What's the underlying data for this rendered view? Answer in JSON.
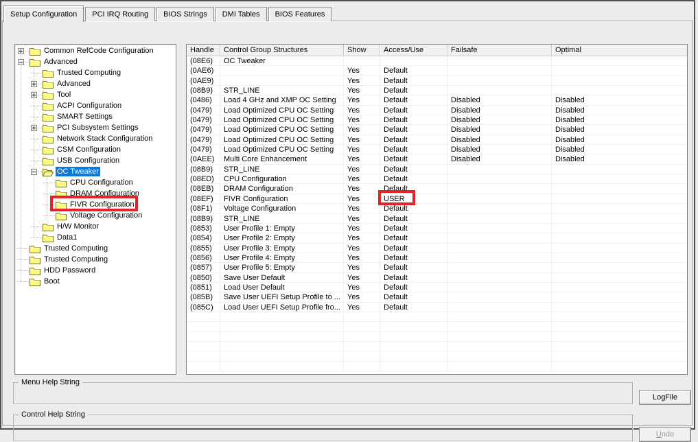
{
  "tabs": [
    {
      "label": "Setup Configuration",
      "active": true
    },
    {
      "label": "PCI IRQ Routing",
      "active": false
    },
    {
      "label": "BIOS Strings",
      "active": false
    },
    {
      "label": "DMI Tables",
      "active": false
    },
    {
      "label": "BIOS Features",
      "active": false
    }
  ],
  "tree": {
    "items": [
      {
        "label": "Common RefCode Configuration",
        "level": 0,
        "expander": "plus",
        "icon": "folder-closed-icon"
      },
      {
        "label": "Advanced",
        "level": 0,
        "expander": "minus",
        "icon": "folder-closed-icon"
      },
      {
        "label": "Trusted Computing",
        "level": 1,
        "expander": null,
        "icon": "folder-closed-icon"
      },
      {
        "label": "Advanced",
        "level": 1,
        "expander": "plus",
        "icon": "folder-closed-icon"
      },
      {
        "label": "Tool",
        "level": 1,
        "expander": "plus",
        "icon": "folder-closed-icon"
      },
      {
        "label": "ACPI Configuration",
        "level": 1,
        "expander": null,
        "icon": "folder-closed-icon"
      },
      {
        "label": "SMART Settings",
        "level": 1,
        "expander": null,
        "icon": "folder-closed-icon"
      },
      {
        "label": "PCI Subsystem Settings",
        "level": 1,
        "expander": "plus",
        "icon": "folder-closed-icon"
      },
      {
        "label": "Network Stack Configuration",
        "level": 1,
        "expander": null,
        "icon": "folder-closed-icon"
      },
      {
        "label": "CSM Configuration",
        "level": 1,
        "expander": null,
        "icon": "folder-closed-icon"
      },
      {
        "label": "USB Configuration",
        "level": 1,
        "expander": null,
        "icon": "folder-closed-icon"
      },
      {
        "label": "OC Tweaker",
        "level": 1,
        "expander": "minus",
        "icon": "folder-open-icon",
        "selected": true
      },
      {
        "label": "CPU Configuration",
        "level": 2,
        "expander": null,
        "icon": "folder-closed-icon"
      },
      {
        "label": "DRAM Configuration",
        "level": 2,
        "expander": null,
        "icon": "folder-closed-icon"
      },
      {
        "label": "FIVR Configuration",
        "level": 2,
        "expander": null,
        "icon": "folder-closed-icon",
        "red_box": true
      },
      {
        "label": "Voltage Configuration",
        "level": 2,
        "expander": null,
        "icon": "folder-closed-icon"
      },
      {
        "label": "H/W Monitor",
        "level": 1,
        "expander": null,
        "icon": "folder-closed-icon"
      },
      {
        "label": "Data1",
        "level": 1,
        "expander": null,
        "icon": "folder-closed-icon"
      },
      {
        "label": "Trusted Computing",
        "level": 0,
        "expander": null,
        "icon": "folder-closed-icon"
      },
      {
        "label": "Trusted Computing",
        "level": 0,
        "expander": null,
        "icon": "folder-closed-icon"
      },
      {
        "label": "HDD Password",
        "level": 0,
        "expander": null,
        "icon": "folder-closed-icon"
      },
      {
        "label": "Boot",
        "level": 0,
        "expander": null,
        "icon": "folder-closed-icon"
      }
    ]
  },
  "table": {
    "columns": [
      "Handle",
      "Control Group Structures",
      "Show",
      "Access/Use",
      "Failsafe",
      "Optimal"
    ],
    "rows": [
      {
        "handle": "(08E6)",
        "name": "OC Tweaker",
        "show": "",
        "access": "",
        "failsafe": "",
        "optimal": ""
      },
      {
        "handle": "(0AE6)",
        "name": "",
        "show": "Yes",
        "access": "Default",
        "failsafe": "",
        "optimal": ""
      },
      {
        "handle": "(0AE9)",
        "name": "",
        "show": "Yes",
        "access": "Default",
        "failsafe": "",
        "optimal": ""
      },
      {
        "handle": "(08B9)",
        "name": "STR_LINE",
        "show": "Yes",
        "access": "Default",
        "failsafe": "",
        "optimal": ""
      },
      {
        "handle": "(0486)",
        "name": "Load 4 GHz and XMP OC Setting",
        "show": "Yes",
        "access": "Default",
        "failsafe": "Disabled",
        "optimal": "Disabled"
      },
      {
        "handle": "(0479)",
        "name": "Load Optimized CPU OC Setting",
        "show": "Yes",
        "access": "Default",
        "failsafe": "Disabled",
        "optimal": "Disabled"
      },
      {
        "handle": "(0479)",
        "name": "Load Optimized CPU OC Setting",
        "show": "Yes",
        "access": "Default",
        "failsafe": "Disabled",
        "optimal": "Disabled"
      },
      {
        "handle": "(0479)",
        "name": "Load Optimized CPU OC Setting",
        "show": "Yes",
        "access": "Default",
        "failsafe": "Disabled",
        "optimal": "Disabled"
      },
      {
        "handle": "(0479)",
        "name": "Load Optimized CPU OC Setting",
        "show": "Yes",
        "access": "Default",
        "failsafe": "Disabled",
        "optimal": "Disabled"
      },
      {
        "handle": "(0479)",
        "name": "Load Optimized CPU OC Setting",
        "show": "Yes",
        "access": "Default",
        "failsafe": "Disabled",
        "optimal": "Disabled"
      },
      {
        "handle": "(0AEE)",
        "name": "Multi Core Enhancement",
        "show": "Yes",
        "access": "Default",
        "failsafe": "Disabled",
        "optimal": "Disabled"
      },
      {
        "handle": "(08B9)",
        "name": "STR_LINE",
        "show": "Yes",
        "access": "Default",
        "failsafe": "",
        "optimal": ""
      },
      {
        "handle": "(08ED)",
        "name": "CPU Configuration",
        "show": "Yes",
        "access": "Default",
        "failsafe": "",
        "optimal": ""
      },
      {
        "handle": "(08EB)",
        "name": "DRAM Configuration",
        "show": "Yes",
        "access": "Default",
        "failsafe": "",
        "optimal": ""
      },
      {
        "handle": "(08EF)",
        "name": "FIVR Configuration",
        "show": "Yes",
        "access": "USER",
        "failsafe": "",
        "optimal": "",
        "red_box": true
      },
      {
        "handle": "(08F1)",
        "name": "Voltage Configuration",
        "show": "Yes",
        "access": "Default",
        "failsafe": "",
        "optimal": ""
      },
      {
        "handle": "(08B9)",
        "name": "STR_LINE",
        "show": "Yes",
        "access": "Default",
        "failsafe": "",
        "optimal": ""
      },
      {
        "handle": "(0853)",
        "name": "User Profile 1: Empty",
        "show": "Yes",
        "access": "Default",
        "failsafe": "",
        "optimal": ""
      },
      {
        "handle": "(0854)",
        "name": "User Profile 2: Empty",
        "show": "Yes",
        "access": "Default",
        "failsafe": "",
        "optimal": ""
      },
      {
        "handle": "(0855)",
        "name": "User Profile 3: Empty",
        "show": "Yes",
        "access": "Default",
        "failsafe": "",
        "optimal": ""
      },
      {
        "handle": "(0856)",
        "name": "User Profile 4: Empty",
        "show": "Yes",
        "access": "Default",
        "failsafe": "",
        "optimal": ""
      },
      {
        "handle": "(0857)",
        "name": "User Profile 5: Empty",
        "show": "Yes",
        "access": "Default",
        "failsafe": "",
        "optimal": ""
      },
      {
        "handle": "(0850)",
        "name": "Save User Default",
        "show": "Yes",
        "access": "Default",
        "failsafe": "",
        "optimal": ""
      },
      {
        "handle": "(0851)",
        "name": "Load User Default",
        "show": "Yes",
        "access": "Default",
        "failsafe": "",
        "optimal": ""
      },
      {
        "handle": "(085B)",
        "name": "Save User UEFI Setup Profile to ...",
        "show": "Yes",
        "access": "Default",
        "failsafe": "",
        "optimal": ""
      },
      {
        "handle": "(085C)",
        "name": "Load User UEFI Setup Profile fro...",
        "show": "Yes",
        "access": "Default",
        "failsafe": "",
        "optimal": ""
      }
    ],
    "empty_filler_rows": 6
  },
  "help": {
    "menu_group_label": "Menu Help String",
    "menu_text": "",
    "control_group_label": "Control Help String",
    "control_text": ""
  },
  "buttons": {
    "logfile_label": "LogFile",
    "undo_underline_letter": "U",
    "undo_rest": "ndo"
  },
  "colors": {
    "selection_blue": "#0b79d8",
    "annotation_red": "#e3242b",
    "folder_yellow": "#fcf87f",
    "window_background": "#ececec"
  }
}
